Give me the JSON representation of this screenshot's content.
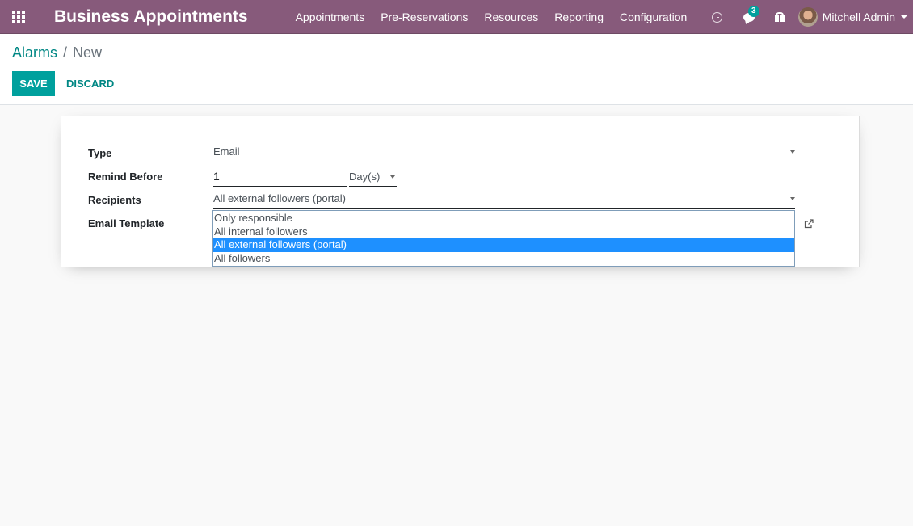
{
  "navbar": {
    "brand": "Business Appointments",
    "menu": [
      "Appointments",
      "Pre-Reservations",
      "Resources",
      "Reporting",
      "Configuration"
    ],
    "chat_count": "3",
    "user_name": "Mitchell Admin",
    "bg_color": "#875a7b"
  },
  "breadcrumb": {
    "parent": "Alarms",
    "separator": "/",
    "current": "New"
  },
  "buttons": {
    "save": "SAVE",
    "discard": "DISCARD"
  },
  "form": {
    "type_label": "Type",
    "type_value": "Email",
    "remind_label": "Remind Before",
    "remind_value": "1",
    "remind_unit": "Day(s)",
    "recipients_label": "Recipients",
    "recipients_value": "All external followers (portal)",
    "template_label": "Email Template"
  },
  "recipients_dropdown": {
    "options": [
      "Only responsible",
      "All internal followers",
      "All external followers (portal)",
      "All followers"
    ],
    "selected_index": 2
  },
  "colors": {
    "accent": "#00a09d",
    "link": "#008784",
    "highlight": "#1e90ff"
  }
}
